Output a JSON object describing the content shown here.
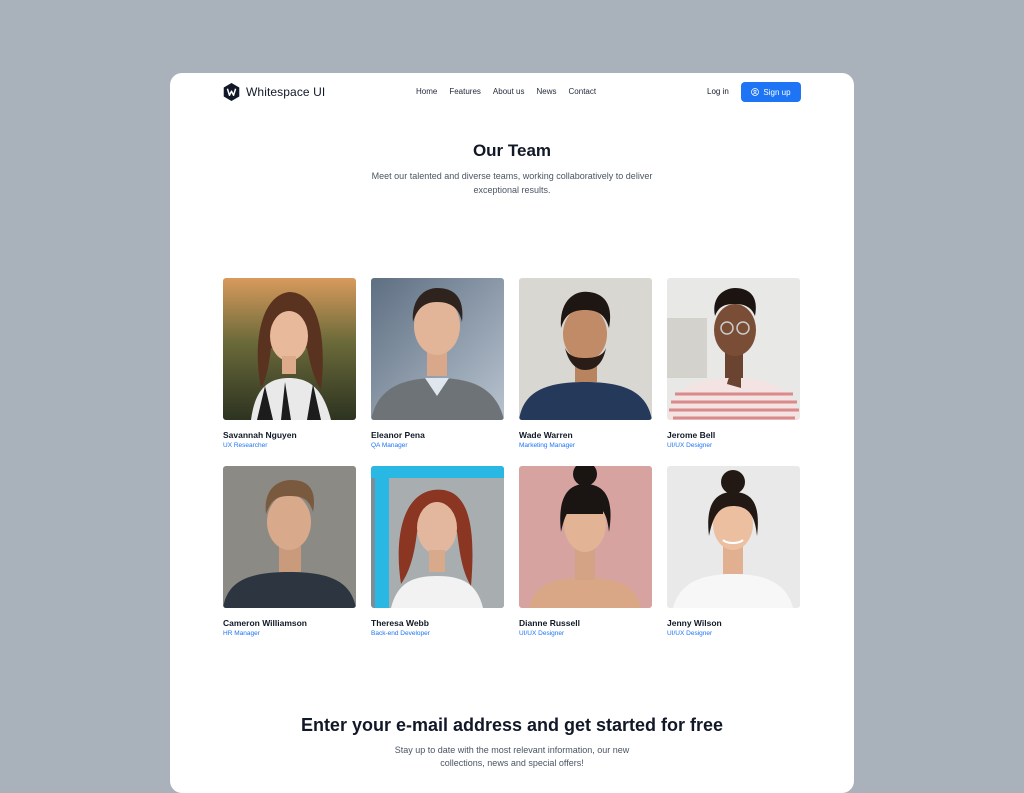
{
  "brand": {
    "name": "Whitespace UI",
    "logo_icon": "hexagon-w-logo-icon"
  },
  "nav": {
    "links": [
      "Home",
      "Features",
      "About us",
      "News",
      "Contact"
    ],
    "login": "Log in",
    "signup": "Sign up",
    "signup_icon": "user-circle-icon"
  },
  "colors": {
    "accent": "#1d74f5",
    "page_bg": "#a9b1ba",
    "card_bg": "#ffffff",
    "text": "#111827"
  },
  "team": {
    "title": "Our Team",
    "subtitle": "Meet our talented and diverse teams, working collaboratively to deliver exceptional results.",
    "members": [
      {
        "name": "Savannah Nguyen",
        "role": "UX Researcher"
      },
      {
        "name": "Eleanor Pena",
        "role": "QA Manager"
      },
      {
        "name": "Wade Warren",
        "role": "Marketing Manager"
      },
      {
        "name": "Jerome Bell",
        "role": "UI/UX Designer"
      },
      {
        "name": "Cameron Williamson",
        "role": "HR Manager"
      },
      {
        "name": "Theresa Webb",
        "role": "Back-end Developer"
      },
      {
        "name": "Dianne Russell",
        "role": "UI/UX Designer"
      },
      {
        "name": "Jenny Wilson",
        "role": "UI/UX Designer"
      }
    ]
  },
  "newsletter": {
    "title": "Enter your e-mail address and get started for free",
    "subtitle": "Stay up to date with the most relevant information, our new collections, news and special offers!"
  }
}
